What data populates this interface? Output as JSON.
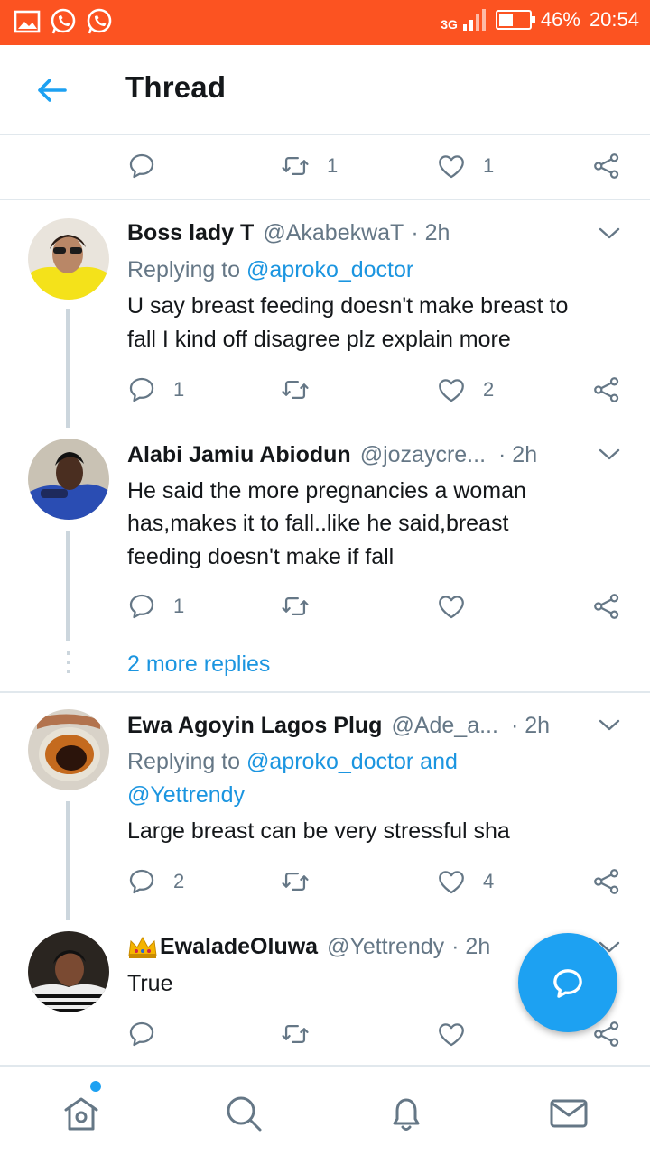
{
  "status_bar": {
    "network": "3G",
    "battery": "46%",
    "battery_level": 0.46,
    "time": "20:54"
  },
  "header": {
    "title": "Thread"
  },
  "top_actions": {
    "retweet_count": "1",
    "like_count": "1"
  },
  "tweets": [
    {
      "name": "Boss lady T",
      "handle": "@AkabekwaT",
      "time": "· 2h",
      "reply_label": "Replying to",
      "reply_to": "@aproko_doctor",
      "lines": [
        "U say breast feeding doesn't make breast to",
        "fall I kind off disagree plz explain more"
      ],
      "reply_count": "1",
      "retweet_count": "",
      "like_count": "2"
    },
    {
      "name": "Alabi Jamiu Abiodun",
      "handle": "@jozaycre...",
      "time": "· 2h",
      "lines": [
        "He said the more pregnancies a woman",
        "has,makes it to fall..like he said,breast",
        "feeding doesn't make if fall"
      ],
      "reply_count": "1",
      "retweet_count": "",
      "like_count": ""
    },
    {
      "name": "Ewa Agoyin Lagos Plug",
      "handle": "@Ade_a...",
      "time": "· 2h",
      "reply_label": "Replying to",
      "reply_to": "@aproko_doctor and",
      "reply_to_2": "@Yettrendy",
      "lines": [
        "Large breast can be very stressful sha"
      ],
      "reply_count": "2",
      "retweet_count": "",
      "like_count": "4"
    },
    {
      "name": "EwaladeOluwa",
      "handle": "@Yettrendy",
      "time": "· 2h",
      "lines": [
        "True"
      ],
      "reply_count": "",
      "retweet_count": "",
      "like_count": ""
    }
  ],
  "more_replies": "2 more replies",
  "colors": {
    "status_bar": "#fc5321",
    "accent": "#1da1f2",
    "link": "#1b95e0",
    "muted": "#657786"
  },
  "icons": [
    "back-arrow-icon",
    "reply-icon",
    "retweet-icon",
    "like-icon",
    "share-icon",
    "chevron-down-icon",
    "compose-icon",
    "home-icon",
    "search-icon",
    "notifications-icon",
    "messages-icon"
  ]
}
